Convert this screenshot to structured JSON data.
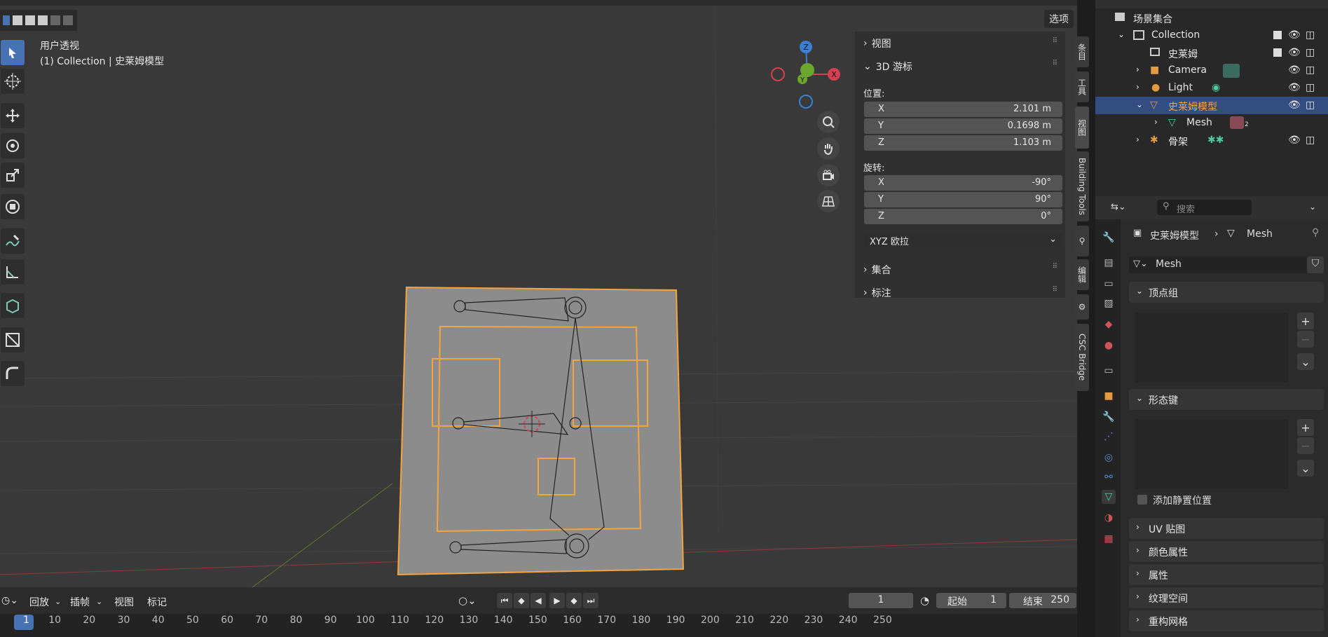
{
  "viewport": {
    "view_name": "用户透视",
    "collection_line": "(1) Collection | 史莱姆模型",
    "options_label": "选项"
  },
  "npanel": {
    "view_header": "视图",
    "cursor_header": "3D 游标",
    "location_label": "位置:",
    "location": [
      {
        "axis": "X",
        "value": "2.101 m"
      },
      {
        "axis": "Y",
        "value": "0.1698 m"
      },
      {
        "axis": "Z",
        "value": "1.103 m"
      }
    ],
    "rotation_label": "旋转:",
    "rotation": [
      {
        "axis": "X",
        "value": "-90°"
      },
      {
        "axis": "Y",
        "value": "90°"
      },
      {
        "axis": "Z",
        "value": "0°"
      }
    ],
    "rotation_mode": "XYZ 欧拉",
    "collection_header": "集合",
    "annotation_header": "标注"
  },
  "side_tabs": [
    "条目",
    "工具",
    "视图",
    "Building Tools",
    "编辑",
    "CSC Bridge"
  ],
  "gizmo": {
    "z": "Z",
    "x": "X",
    "y": "Y"
  },
  "outliner": {
    "search_placeholder": "搜索",
    "rows": [
      {
        "name": "场景集合"
      },
      {
        "name": "Collection"
      },
      {
        "name": "史莱姆"
      },
      {
        "name": "Camera"
      },
      {
        "name": "Light"
      },
      {
        "name": "史莱姆模型"
      },
      {
        "name": "Mesh",
        "badge": "2"
      },
      {
        "name": "骨架"
      }
    ]
  },
  "properties": {
    "search_placeholder": "搜索",
    "breadcrumb_object": "史莱姆模型",
    "breadcrumb_data": "Mesh",
    "mesh_name": "Mesh",
    "vertex_groups": "顶点组",
    "shape_keys": "形态键",
    "add_rest_position": "添加静置位置",
    "uv_maps": "UV 贴图",
    "color_attributes": "颜色属性",
    "attributes": "属性",
    "texture_space": "纹理空间",
    "remesh": "重构网格"
  },
  "timeline": {
    "playback": "回放",
    "keying": "插帧",
    "view": "视图",
    "marker": "标记",
    "current_frame": "1",
    "start_label": "起始",
    "start_value": "1",
    "end_label": "结束",
    "end_value": "250",
    "ticks": [
      "1",
      "10",
      "20",
      "30",
      "40",
      "50",
      "60",
      "70",
      "80",
      "90",
      "100",
      "110",
      "120",
      "130",
      "140",
      "150",
      "160",
      "170",
      "180",
      "190",
      "200",
      "210",
      "220",
      "230",
      "240",
      "250"
    ]
  },
  "colors": {
    "accent": "#4772b3",
    "selection": "#f5a442",
    "x_axis": "#d43f52",
    "y_axis": "#6da62d",
    "z_axis": "#3b7fd1"
  }
}
